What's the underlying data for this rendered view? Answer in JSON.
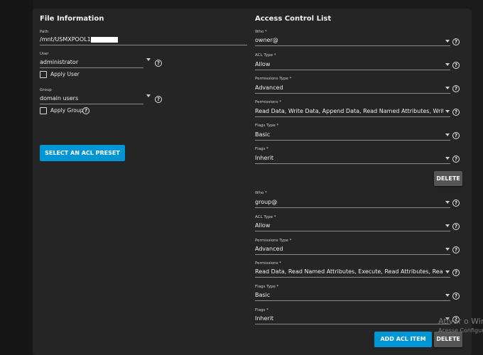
{
  "file_info": {
    "title": "File Information",
    "path": {
      "label": "Path",
      "value": "/mnt/USMXPOOL1/US"
    },
    "user": {
      "label": "User",
      "value": "administrator",
      "apply_label": "Apply User"
    },
    "group": {
      "label": "Group",
      "value": "domain users",
      "apply_label": "Apply Group"
    },
    "preset_button": "SELECT AN ACL PRESET"
  },
  "acl": {
    "title": "Access Control List",
    "labels": {
      "who": "Who *",
      "acl_type": "ACL Type *",
      "permissions_type": "Permissions Type *",
      "permissions": "Permissions *",
      "flags_type": "Flags Type *",
      "flags": "Flags *"
    },
    "items": [
      {
        "who": "owner@",
        "acl_type": "Allow",
        "permissions_type": "Advanced",
        "permissions": "Read Data, Write Data, Append Data, Read Named Attributes, Writ…",
        "flags_type": "Basic",
        "flags": "Inherit"
      },
      {
        "who": "group@",
        "acl_type": "Allow",
        "permissions_type": "Advanced",
        "permissions": "Read Data, Read Named Attributes, Execute, Read Attributes, Rea…",
        "flags_type": "Basic",
        "flags": "Inherit"
      }
    ],
    "delete_button": "DELETE",
    "add_button": "ADD ACL ITEM"
  },
  "help_glyph": "?",
  "watermark": {
    "line1": "Ativar o Win",
    "line2": "Acesse Configur"
  },
  "colors": {
    "accent": "#0095d5",
    "panel": "#252525",
    "background": "#1b1b1b",
    "secondary_button": "#555555"
  }
}
